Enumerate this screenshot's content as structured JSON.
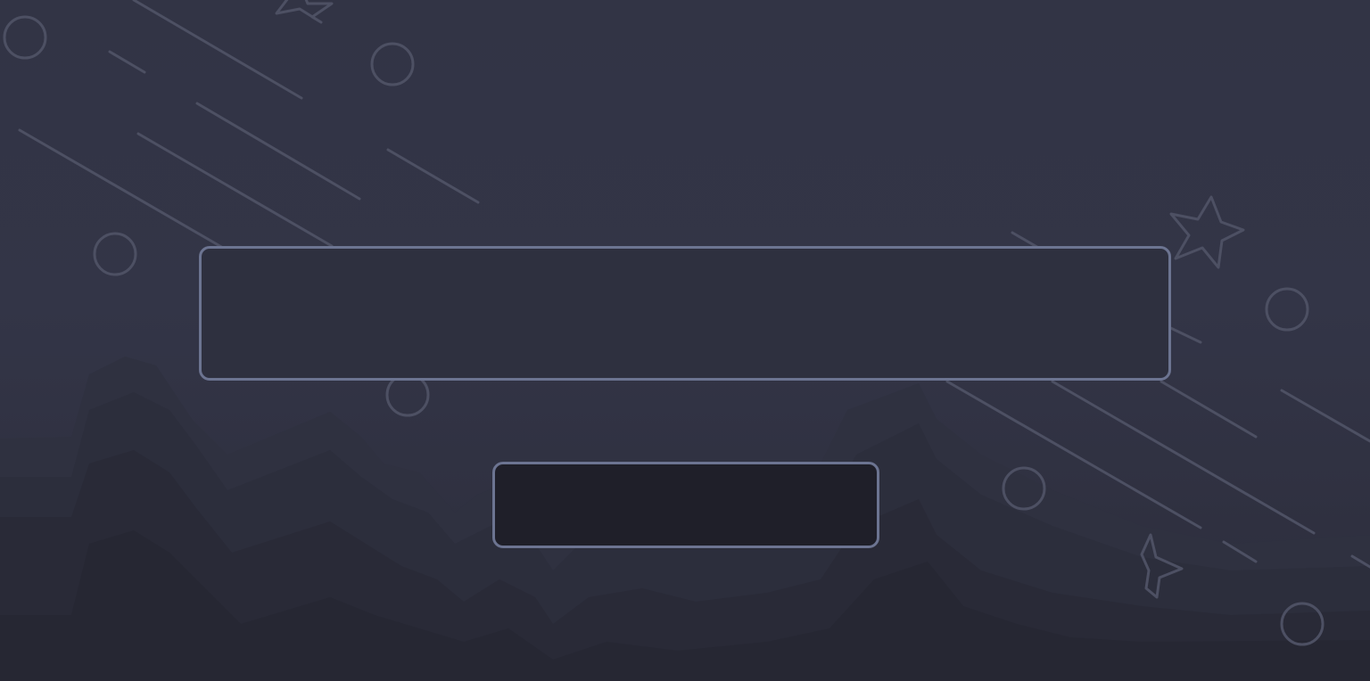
{
  "main": {
    "input": {
      "value": "",
      "placeholder": ""
    },
    "button": {
      "label": ""
    }
  },
  "colors": {
    "background": "#323445",
    "panel_fill": "#2e303f",
    "panel_border": "#6c7491",
    "button_fill": "#1f1f29",
    "decoration_stroke": "#4d5063"
  },
  "decorations": {
    "icons": [
      "circle-icon",
      "star-icon"
    ]
  }
}
